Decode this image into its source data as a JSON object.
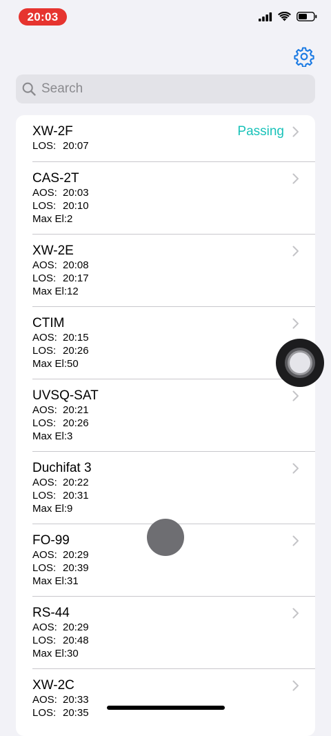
{
  "status_bar": {
    "time": "20:03",
    "time_pill_color": "#e6342f",
    "icons": [
      "cellular-signal-icon",
      "wifi-icon",
      "battery-icon"
    ]
  },
  "toolbar": {
    "settings_icon": "gear-icon",
    "accent_color": "#1a7ae3"
  },
  "search": {
    "placeholder": "Search",
    "value": ""
  },
  "labels": {
    "aos": "AOS:",
    "los": "LOS:",
    "max_el": "Max El:"
  },
  "passing_color": "#19c2b9",
  "satellites": [
    {
      "name": "XW-2F",
      "status": "Passing",
      "los": "20:07"
    },
    {
      "name": "CAS-2T",
      "aos": "20:03",
      "los": "20:10",
      "max_el": "2"
    },
    {
      "name": "XW-2E",
      "aos": "20:08",
      "los": "20:17",
      "max_el": "12"
    },
    {
      "name": "CTIM",
      "aos": "20:15",
      "los": "20:26",
      "max_el": "50"
    },
    {
      "name": "UVSQ-SAT",
      "aos": "20:21",
      "los": "20:26",
      "max_el": "3"
    },
    {
      "name": "Duchifat 3",
      "aos": "20:22",
      "los": "20:31",
      "max_el": "9"
    },
    {
      "name": "FO-99",
      "aos": "20:29",
      "los": "20:39",
      "max_el": "31"
    },
    {
      "name": "RS-44",
      "aos": "20:29",
      "los": "20:48",
      "max_el": "30"
    },
    {
      "name": "XW-2C",
      "aos": "20:33",
      "los": "20:35"
    }
  ]
}
